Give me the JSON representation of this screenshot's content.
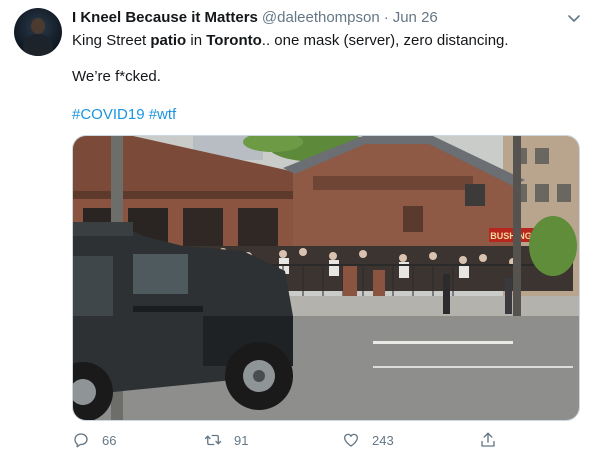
{
  "author": {
    "name": "I Kneel Because it Matters",
    "handle": "@daleethompson",
    "separator": "·",
    "date": "Jun 26"
  },
  "tweet": {
    "line1_parts": [
      "King Street ",
      "patio",
      " in ",
      "Toronto",
      ".. one mask (server), zero distancing."
    ],
    "line2": "We’re f*cked.",
    "hashtags": [
      "#COVID19",
      "#wtf"
    ]
  },
  "media": {
    "sign_text": "BUSHINGS"
  },
  "actions": {
    "reply_count": "66",
    "retweet_count": "91",
    "like_count": "243"
  },
  "icons": [
    "caret-down-icon",
    "reply-icon",
    "retweet-icon",
    "like-icon",
    "share-icon"
  ],
  "colors": {
    "link": "#1b95e0",
    "muted": "#657786",
    "text": "#14171a"
  }
}
